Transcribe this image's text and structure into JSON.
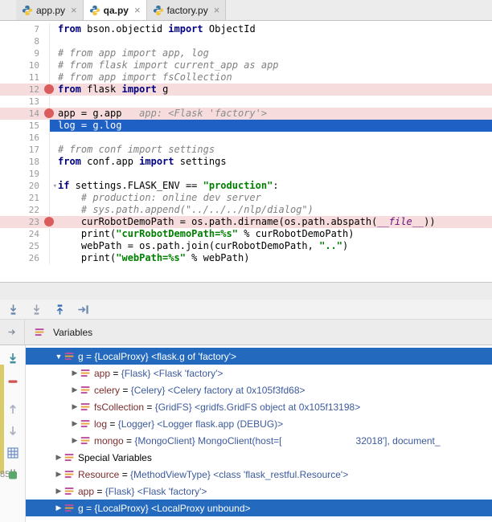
{
  "colors": {
    "selection_blue": "#2369BD",
    "execution_line_blue": "#1F60C4",
    "breakpoint_line_pink": "#F6DCDC",
    "breakpoint_red": "#DB5C5C"
  },
  "tabs": [
    {
      "label": "app.py",
      "active": false,
      "icon": "python-file-icon",
      "close": "×"
    },
    {
      "label": "qa.py",
      "active": true,
      "icon": "python-file-icon",
      "close": "×"
    },
    {
      "label": "factory.py",
      "active": false,
      "icon": "python-file-icon",
      "close": "×"
    }
  ],
  "editor": {
    "lines": [
      {
        "num": 7,
        "tokens": [
          [
            "kw",
            "from"
          ],
          [
            "pl",
            " bson.objectid "
          ],
          [
            "kw",
            "import"
          ],
          [
            "pl",
            " ObjectId"
          ]
        ]
      },
      {
        "num": 8,
        "tokens": []
      },
      {
        "num": 9,
        "tokens": [
          [
            "cm",
            "# from app import app, log"
          ]
        ]
      },
      {
        "num": 10,
        "tokens": [
          [
            "cm",
            "# from flask import current_app as app"
          ]
        ]
      },
      {
        "num": 11,
        "tokens": [
          [
            "cm",
            "# from app import fsCollection"
          ]
        ]
      },
      {
        "num": 12,
        "bg": "breakpoint",
        "breakpoint": true,
        "tokens": [
          [
            "kw",
            "from"
          ],
          [
            "pl",
            " flask "
          ],
          [
            "kw",
            "import"
          ],
          [
            "pl",
            " g"
          ]
        ]
      },
      {
        "num": 13,
        "tokens": []
      },
      {
        "num": 14,
        "bg": "breakpoint",
        "breakpoint": true,
        "tokens": [
          [
            "pl",
            "app = g.app"
          ],
          [
            "hint",
            "   app: <Flask 'factory'>"
          ]
        ]
      },
      {
        "num": 15,
        "bg": "exec",
        "tokens": [
          [
            "pl",
            "log = g.log"
          ]
        ]
      },
      {
        "num": 16,
        "tokens": []
      },
      {
        "num": 17,
        "tokens": [
          [
            "cm",
            "# from conf import settings"
          ]
        ]
      },
      {
        "num": 18,
        "tokens": [
          [
            "kw",
            "from"
          ],
          [
            "pl",
            " conf.app "
          ],
          [
            "kw",
            "import"
          ],
          [
            "pl",
            " settings"
          ]
        ]
      },
      {
        "num": 19,
        "tokens": []
      },
      {
        "num": 20,
        "fold": true,
        "tokens": [
          [
            "kw",
            "if"
          ],
          [
            "pl",
            " settings.FLASK_ENV == "
          ],
          [
            "st",
            "\"production\""
          ],
          [
            "pl",
            ":"
          ]
        ]
      },
      {
        "num": 21,
        "tokens": [
          [
            "cm",
            "    # production: online dev server"
          ]
        ]
      },
      {
        "num": 22,
        "tokens": [
          [
            "cm",
            "    # sys.path.append(\"../../../nlp/dialog\")"
          ]
        ]
      },
      {
        "num": 23,
        "bg": "breakpoint",
        "breakpoint": true,
        "tokens": [
          [
            "pl",
            "    curRobotDemoPath = os.path.dirname(os.path.abspath("
          ],
          [
            "du",
            "__file__"
          ],
          [
            "pl",
            "))"
          ]
        ]
      },
      {
        "num": 24,
        "tokens": [
          [
            "pl",
            "    print("
          ],
          [
            "st",
            "\"curRobotDemoPath=%s\""
          ],
          [
            "pl",
            " % curRobotDemoPath)"
          ]
        ]
      },
      {
        "num": 25,
        "tokens": [
          [
            "pl",
            "    webPath = os.path.join(curRobotDemoPath, "
          ],
          [
            "st",
            "\"..\""
          ],
          [
            "pl",
            ")"
          ]
        ]
      },
      {
        "num": 26,
        "tokens": [
          [
            "pl",
            "    print("
          ],
          [
            "st",
            "\"webPath=%s\""
          ],
          [
            "pl",
            " % webPath)"
          ]
        ]
      }
    ]
  },
  "debug_toolbar": {
    "icons": [
      "step-into-icon",
      "step-into-my-code-icon",
      "step-out-icon",
      "run-to-cursor-icon"
    ]
  },
  "variables_panel": {
    "tab_label": "Variables",
    "cropped_text": "85",
    "left_toolbar_icons": [
      "show-execution-point-icon",
      "minus-icon",
      "up-arrow-icon",
      "down-arrow-icon",
      "grid-icon",
      "plugin-icon"
    ],
    "rows": [
      {
        "name": "g",
        "type": "{LocalProxy}",
        "value": "<flask.g of 'factory'>",
        "indent": 0,
        "expanded": true,
        "selected": true
      },
      {
        "name": "app",
        "type": "{Flask}",
        "value": "<Flask 'factory'>",
        "indent": 1
      },
      {
        "name": "celery",
        "type": "{Celery}",
        "value": "<Celery factory at 0x105f3fd68>",
        "indent": 1
      },
      {
        "name": "fsCollection",
        "type": "{GridFS}",
        "value": "<gridfs.GridFS object at 0x105f13198>",
        "indent": 1
      },
      {
        "name": "log",
        "type": "{Logger}",
        "value": "<Logger flask.app (DEBUG)>",
        "indent": 1
      },
      {
        "name": "mongo",
        "type": "{MongoClient}",
        "value_prefix": "MongoClient(host=[",
        "redacted": true,
        "value_suffix": "32018'], document_",
        "indent": 1
      },
      {
        "label": "Special Variables",
        "group": true,
        "indent": 0
      },
      {
        "name": "Resource",
        "type": "{MethodViewType}",
        "value": "<class 'flask_restful.Resource'>",
        "indent": 0
      },
      {
        "name": "app",
        "type": "{Flask}",
        "value": "<Flask 'factory'>",
        "indent": 0
      },
      {
        "name": "g",
        "type": "{LocalProxy}",
        "value": "<LocalProxy unbound>",
        "indent": 0,
        "selected": true
      }
    ]
  }
}
